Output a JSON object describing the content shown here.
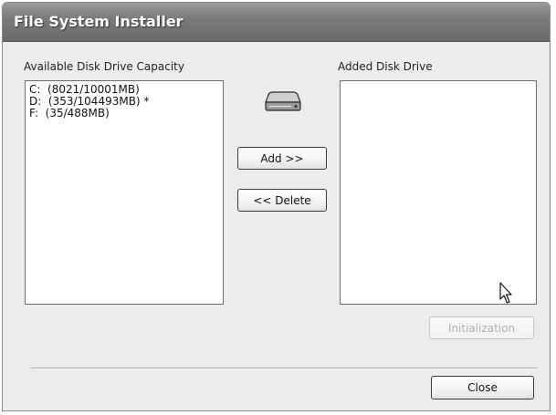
{
  "window": {
    "title": "File System Installer"
  },
  "available": {
    "label": "Available Disk Drive Capacity",
    "items": [
      "C:  (8021/10001MB)",
      "D:  (353/104493MB) *",
      "F:  (35/488MB)"
    ]
  },
  "added": {
    "label": "Added Disk Drive",
    "items": []
  },
  "buttons": {
    "add": "Add >>",
    "delete": "<< Delete",
    "initialization": "Initialization",
    "close": "Close"
  },
  "icons": {
    "drive": "hard-drive-icon",
    "cursor": "mouse-pointer-icon"
  }
}
